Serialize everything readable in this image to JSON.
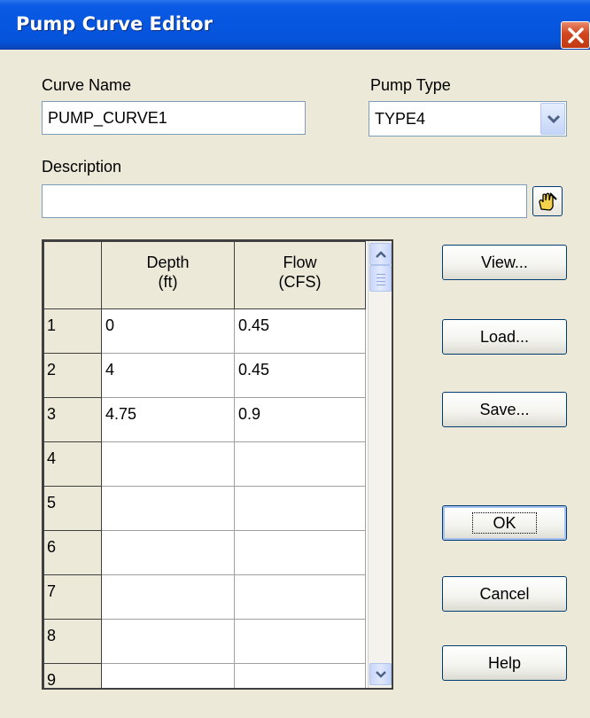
{
  "window": {
    "title": "Pump Curve Editor"
  },
  "curve_name": {
    "label": "Curve Name",
    "value": "PUMP_CURVE1"
  },
  "pump_type": {
    "label": "Pump Type",
    "value": "TYPE4"
  },
  "description": {
    "label": "Description",
    "value": ""
  },
  "grid": {
    "headers": {
      "depth": [
        "Depth",
        "(ft)"
      ],
      "flow": [
        "Flow",
        "(CFS)"
      ]
    },
    "rows": [
      {
        "num": "1",
        "depth": "0",
        "flow": "0.45"
      },
      {
        "num": "2",
        "depth": "4",
        "flow": "0.45"
      },
      {
        "num": "3",
        "depth": "4.75",
        "flow": "0.9"
      },
      {
        "num": "4",
        "depth": "",
        "flow": ""
      },
      {
        "num": "5",
        "depth": "",
        "flow": ""
      },
      {
        "num": "6",
        "depth": "",
        "flow": ""
      },
      {
        "num": "7",
        "depth": "",
        "flow": ""
      },
      {
        "num": "8",
        "depth": "",
        "flow": ""
      },
      {
        "num": "9",
        "depth": "",
        "flow": ""
      }
    ]
  },
  "buttons": {
    "view": "View...",
    "load": "Load...",
    "save": "Save...",
    "ok": "OK",
    "cancel": "Cancel",
    "help": "Help"
  },
  "icons": {
    "close": "close-icon",
    "dropdown": "chevron-down-icon",
    "edit": "hand-pencil-icon",
    "scroll_up": "scroll-up-icon",
    "scroll_down": "scroll-down-icon"
  },
  "colors": {
    "titlebar": "#0656e0",
    "dialog_bg": "#ece9d8",
    "close": "#d2461e"
  }
}
